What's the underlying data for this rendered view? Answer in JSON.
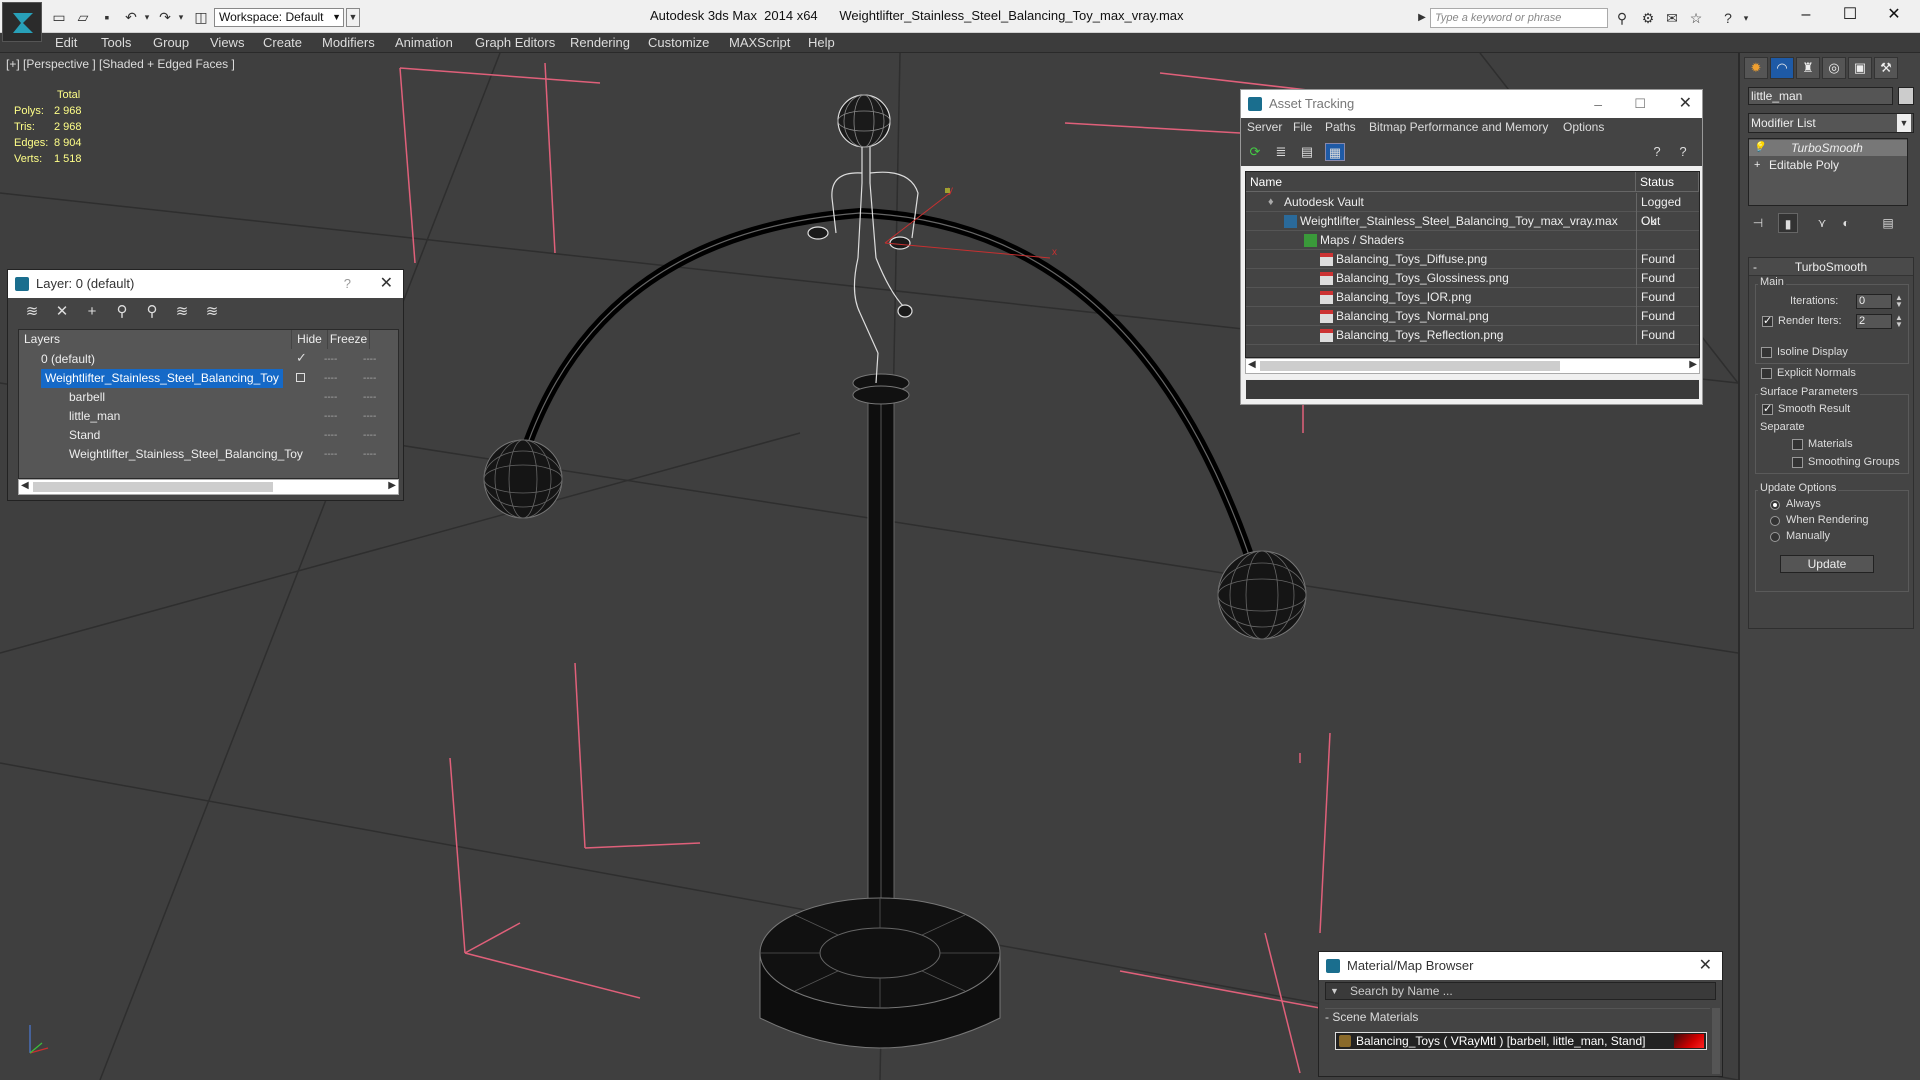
{
  "titlebar": {
    "workspace": "Workspace: Default",
    "app_title": "Autodesk 3ds Max  2014 x64",
    "file_title": "Weightlifter_Stainless_Steel_Balancing_Toy_max_vray.max",
    "search_placeholder": "Type a keyword or phrase"
  },
  "menu": [
    "Edit",
    "Tools",
    "Group",
    "Views",
    "Create",
    "Modifiers",
    "Animation",
    "Graph Editors",
    "Rendering",
    "Customize",
    "MAXScript",
    "Help"
  ],
  "viewport": {
    "label": "[+] [Perspective ] [Shaded + Edged Faces ]",
    "stats": {
      "total_label": "Total",
      "polys_label": "Polys:",
      "polys": "2 968",
      "tris_label": "Tris:",
      "tris": "2 968",
      "edges_label": "Edges:",
      "edges": "8 904",
      "verts_label": "Verts:",
      "verts": "1 518"
    }
  },
  "layer_panel": {
    "title": "Layer: 0 (default)",
    "help": "?",
    "col_layers": "Layers",
    "col_hide": "Hide",
    "col_freeze": "Freeze",
    "rows": [
      {
        "name": "0 (default)"
      },
      {
        "name": "Weightlifter_Stainless_Steel_Balancing_Toy"
      },
      {
        "name": "barbell"
      },
      {
        "name": "little_man"
      },
      {
        "name": "Stand"
      },
      {
        "name": "Weightlifter_Stainless_Steel_Balancing_Toy"
      }
    ],
    "dash": "----"
  },
  "asset_panel": {
    "title": "Asset Tracking",
    "menu": [
      "Server",
      "File",
      "Paths",
      "Bitmap Performance and Memory",
      "Options"
    ],
    "col_name": "Name",
    "col_status": "Status",
    "rows": [
      {
        "name": "Autodesk Vault",
        "status": "Logged Out"
      },
      {
        "name": "Weightlifter_Stainless_Steel_Balancing_Toy_max_vray.max",
        "status": "Ok"
      },
      {
        "name": "Maps / Shaders",
        "status": ""
      },
      {
        "name": "Balancing_Toys_Diffuse.png",
        "status": "Found"
      },
      {
        "name": "Balancing_Toys_Glossiness.png",
        "status": "Found"
      },
      {
        "name": "Balancing_Toys_IOR.png",
        "status": "Found"
      },
      {
        "name": "Balancing_Toys_Normal.png",
        "status": "Found"
      },
      {
        "name": "Balancing_Toys_Reflection.png",
        "status": "Found"
      }
    ]
  },
  "material_browser": {
    "title": "Material/Map Browser",
    "search_placeholder": "Search by Name ...",
    "section": "Scene Materials",
    "item": "Balancing_Toys  ( VRayMtl )  [barbell, little_man, Stand]"
  },
  "command_panel": {
    "object_name": "little_man",
    "modifier_list": "Modifier List",
    "stack": [
      "TurboSmooth",
      "Editable Poly"
    ],
    "turbosmooth": {
      "title": "TurboSmooth",
      "main": "Main",
      "iterations_label": "Iterations:",
      "iterations": "0",
      "render_iters_label": "Render Iters:",
      "render_iters": "2",
      "isoline": "Isoline Display",
      "explicit_normals": "Explicit Normals",
      "surface_params": "Surface Parameters",
      "smooth_result": "Smooth Result",
      "separate": "Separate",
      "materials": "Materials",
      "smoothing_groups": "Smoothing Groups",
      "update_options": "Update Options",
      "always": "Always",
      "when_rendering": "When Rendering",
      "manually": "Manually",
      "update": "Update"
    }
  }
}
